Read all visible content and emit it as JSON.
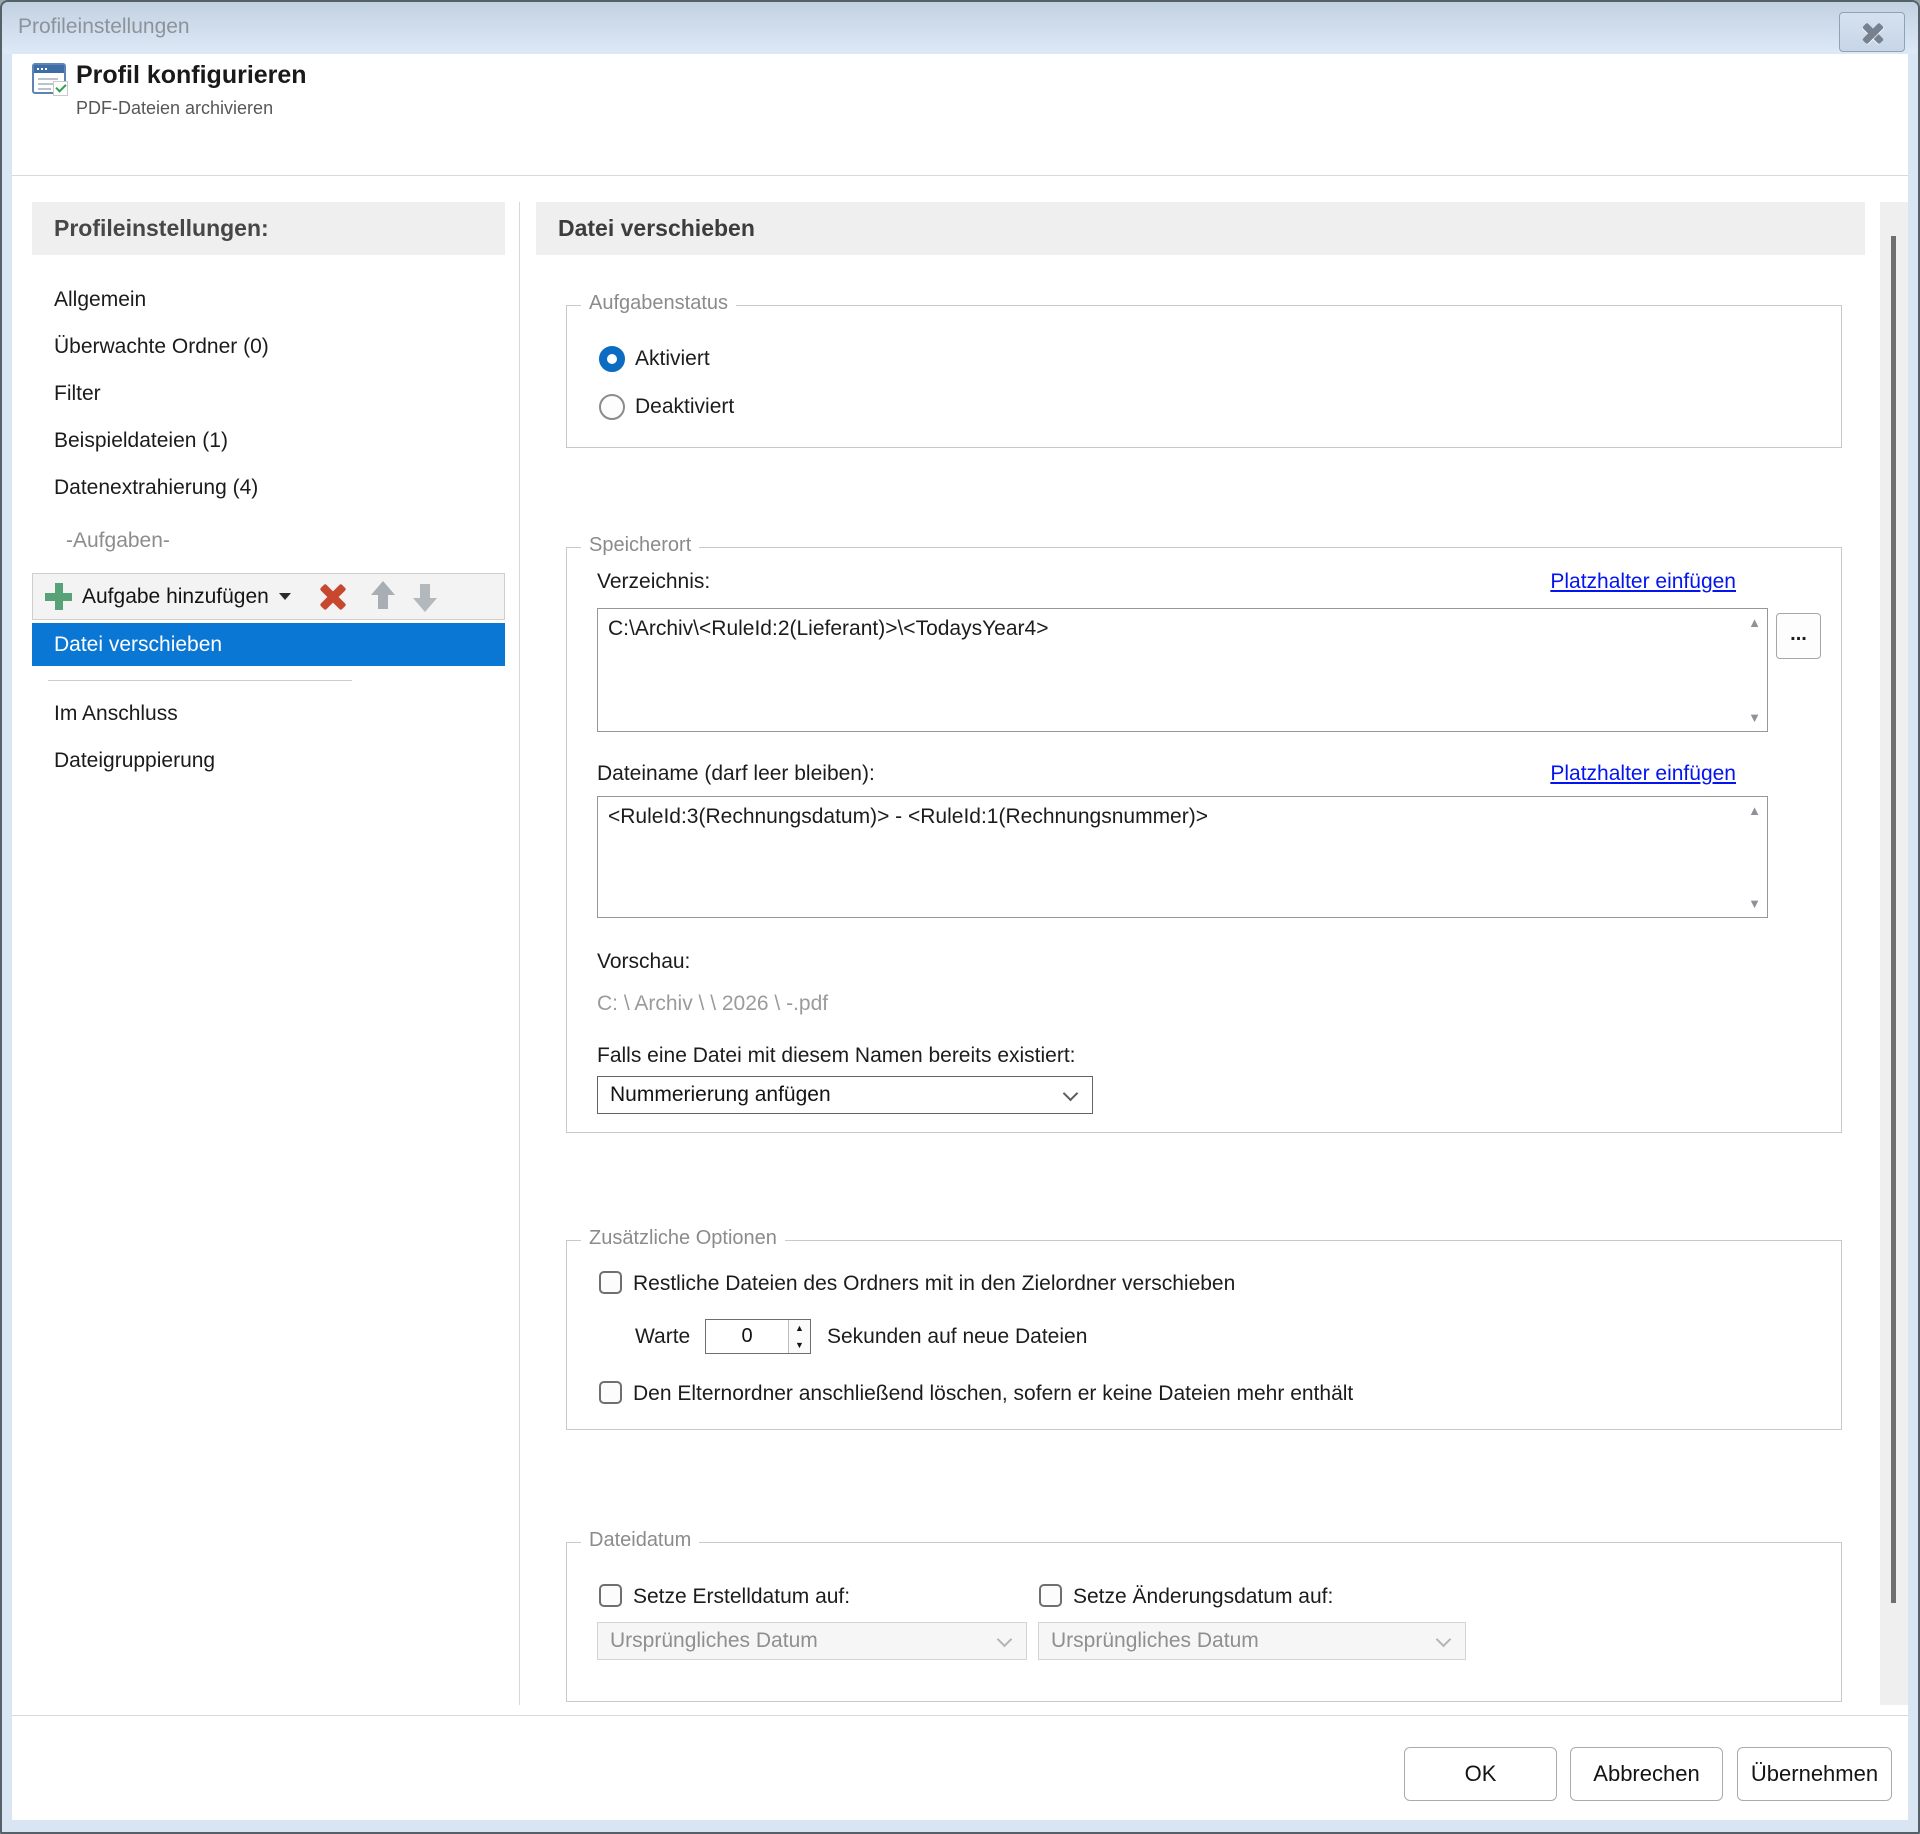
{
  "window": {
    "title": "Profileinstellungen"
  },
  "header": {
    "title": "Profil konfigurieren",
    "subtitle": "PDF-Dateien archivieren"
  },
  "sidebar": {
    "heading": "Profileinstellungen:",
    "items": [
      {
        "label": "Allgemein"
      },
      {
        "label": "Überwachte Ordner (0)"
      },
      {
        "label": "Filter"
      },
      {
        "label": "Beispieldateien (1)"
      },
      {
        "label": "Datenextrahierung (4)"
      }
    ],
    "tasks_separator": "-Aufgaben-",
    "toolbar": {
      "add_task_label": "Aufgabe hinzufügen"
    },
    "task_list": {
      "selected": "Datei verschieben",
      "items": [
        {
          "label": "Im Anschluss"
        },
        {
          "label": "Dateigruppierung"
        }
      ]
    }
  },
  "main": {
    "heading": "Datei verschieben",
    "task_status": {
      "legend": "Aufgabenstatus",
      "enabled_label": "Aktiviert",
      "disabled_label": "Deaktiviert",
      "selected": "Aktiviert"
    },
    "storage": {
      "legend": "Speicherort",
      "directory_label": "Verzeichnis:",
      "directory_placeholder_link": "Platzhalter einfügen",
      "directory_value": "C:\\Archiv\\<RuleId:2(Lieferant)>\\<TodaysYear4>",
      "browse_button": "...",
      "filename_label": "Dateiname (darf leer bleiben):",
      "filename_placeholder_link": "Platzhalter einfügen",
      "filename_value": "<RuleId:3(Rechnungsdatum)> - <RuleId:1(Rechnungsnummer)>",
      "preview_label": "Vorschau:",
      "preview_value": "C: \\ Archiv \\  \\ 2026 \\ -.pdf",
      "conflict_label": "Falls eine Datei mit diesem Namen bereits existiert:",
      "conflict_value": "Nummerierung anfügen"
    },
    "extra_options": {
      "legend": "Zusätzliche Optionen",
      "move_remaining_label": "Restliche Dateien des Ordners mit in den Zielordner verschieben",
      "move_remaining_checked": false,
      "wait_prefix": "Warte",
      "wait_seconds": "0",
      "wait_suffix": "Sekunden auf neue Dateien",
      "delete_parent_label": "Den Elternordner anschließend löschen, sofern er keine Dateien mehr enthält",
      "delete_parent_checked": false
    },
    "file_date": {
      "legend": "Dateidatum",
      "created_label": "Setze Erstelldatum auf:",
      "created_checked": false,
      "created_value": "Ursprüngliches Datum",
      "modified_label": "Setze Änderungsdatum auf:",
      "modified_checked": false,
      "modified_value": "Ursprüngliches Datum"
    }
  },
  "footer": {
    "ok": "OK",
    "cancel": "Abbrechen",
    "apply": "Übernehmen"
  },
  "colors": {
    "selection_blue": "#0a77d4",
    "radio_blue": "#0b6cc1",
    "link_blue": "#0414ee",
    "add_green": "#57a377",
    "delete_red": "#c7482f",
    "titlebar_top": "#c2d1e1",
    "titlebar_bottom": "#dde9f7"
  }
}
